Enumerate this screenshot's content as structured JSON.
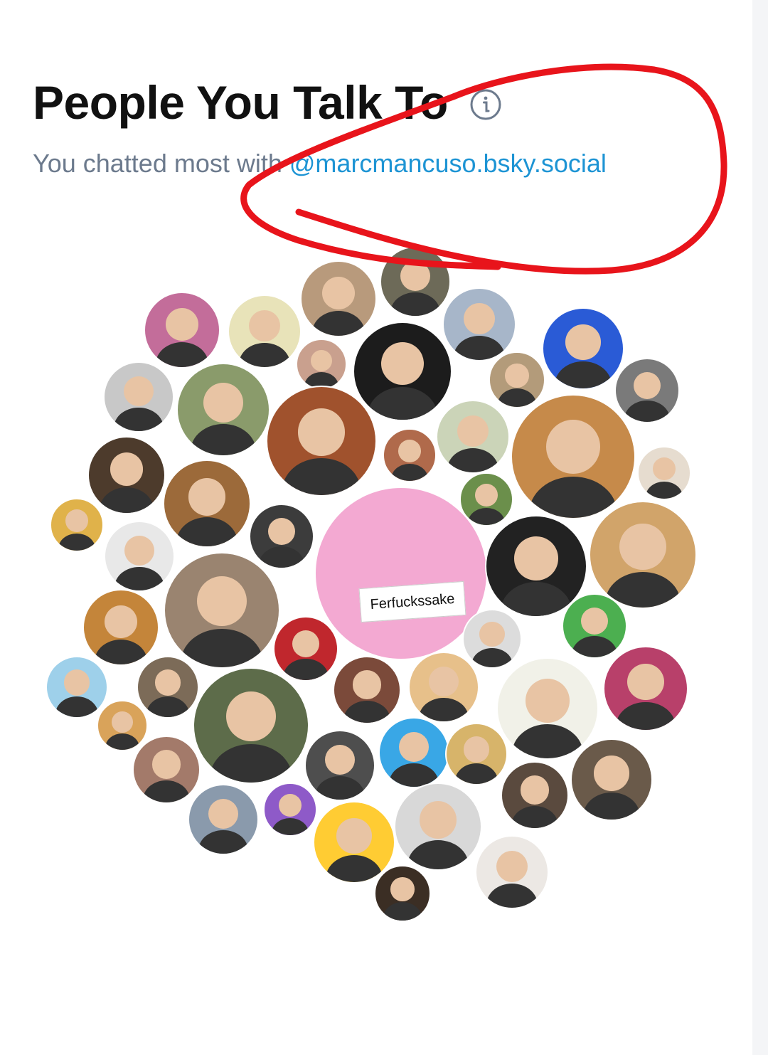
{
  "header": {
    "title": "People You Talk To",
    "subtitle_prefix": "You chatted most with ",
    "top_handle": "@marcmancuso.bsky.social",
    "info_icon": "info-icon"
  },
  "bubble_chart": {
    "center_card_text": "Ferfuckssake",
    "avatar_count": 56
  },
  "annotation": {
    "color": "#e8141b",
    "shape": "hand-drawn-ellipse"
  },
  "colors": {
    "title": "#111111",
    "subtitle": "#6c7a8d",
    "link": "#1d94d4",
    "center_bubble": "#f3a9d2"
  }
}
